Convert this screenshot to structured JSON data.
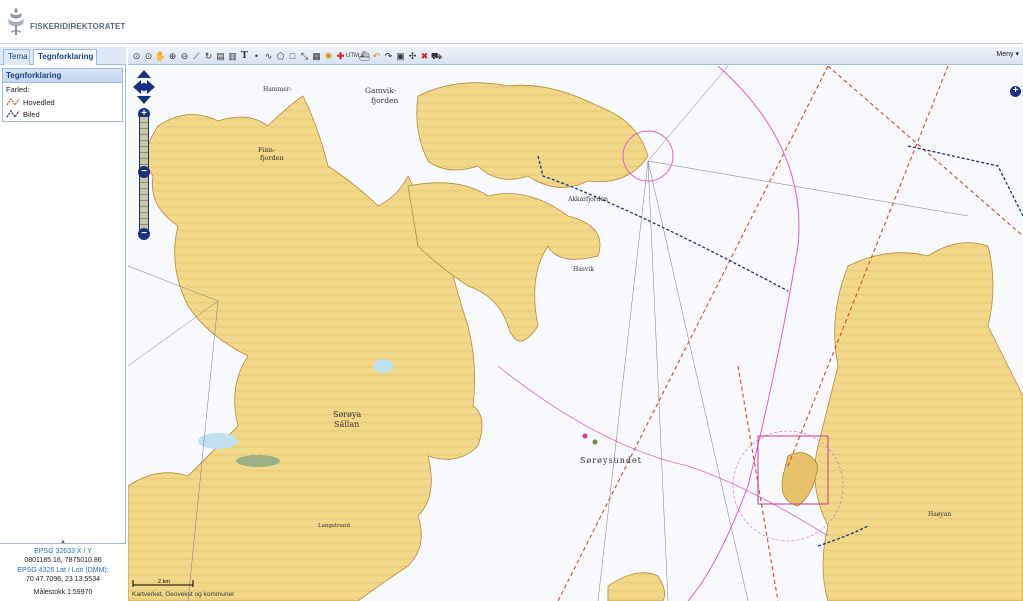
{
  "header": {
    "logo_text": "FISKERIDIREKTORATET"
  },
  "tabs": [
    {
      "label": "Tema"
    },
    {
      "label": "Tegnforklaring"
    }
  ],
  "legend": {
    "title": "Tegnforklaring",
    "category": "Farled:",
    "items": [
      {
        "label": "Hovedled",
        "color": "#d2492a"
      },
      {
        "label": "Biled",
        "color": "#1b2f80"
      }
    ]
  },
  "coords": {
    "utm_label": "EPSG 32633 X / Y",
    "utm_value": "0801185.16, 7875010.86",
    "latlon_label": "EPSG 4326 Lat / Lon (DMM):",
    "latlon_value": "70 47.7096, 23 13.5534",
    "scale": "Målestokk 1:59970"
  },
  "toolbar": {
    "menu_label": "Meny",
    "tools": [
      "binoculars-icon",
      "binoculars-icon",
      "pan-hand-icon",
      "zoom-in-icon",
      "zoom-out-icon",
      "draw-line-icon",
      "refresh-icon",
      "print-icon",
      "print-icon",
      "text-icon",
      "point-icon",
      "line-icon",
      "polygon-icon",
      "rectangle-icon",
      "measure-icon",
      "layers-icon",
      "sun-icon",
      "cross-icon",
      "utm-icon",
      "ship-icon",
      "undo-icon",
      "redo-icon",
      "frame-icon",
      "settings-icon",
      "delete-icon",
      "car-icon"
    ]
  },
  "map": {
    "places": [
      {
        "text": "Gamvik-",
        "size": 7.5
      },
      {
        "text": "fjorden",
        "size": 7.5
      },
      {
        "text": "Finn-",
        "size": 6.5
      },
      {
        "text": "fjorden",
        "size": 6.5
      },
      {
        "text": "Sørøya",
        "size": 8
      },
      {
        "text": "Sállan",
        "size": 8
      },
      {
        "text": "Sørøysundet",
        "size": 8
      },
      {
        "text": "Akkarfjorden",
        "size": 6
      },
      {
        "text": "Hammer-",
        "size": 6
      },
      {
        "text": "Hasvik",
        "size": 6
      },
      {
        "text": "Haøyan",
        "size": 6
      },
      {
        "text": "Langstrand",
        "size": 5.5
      }
    ],
    "scale_label": "2 km",
    "attribution": "Kartverket, Geovekst og kommuner",
    "zoom_in": "+",
    "zoom_out": "−",
    "corner": "+"
  }
}
